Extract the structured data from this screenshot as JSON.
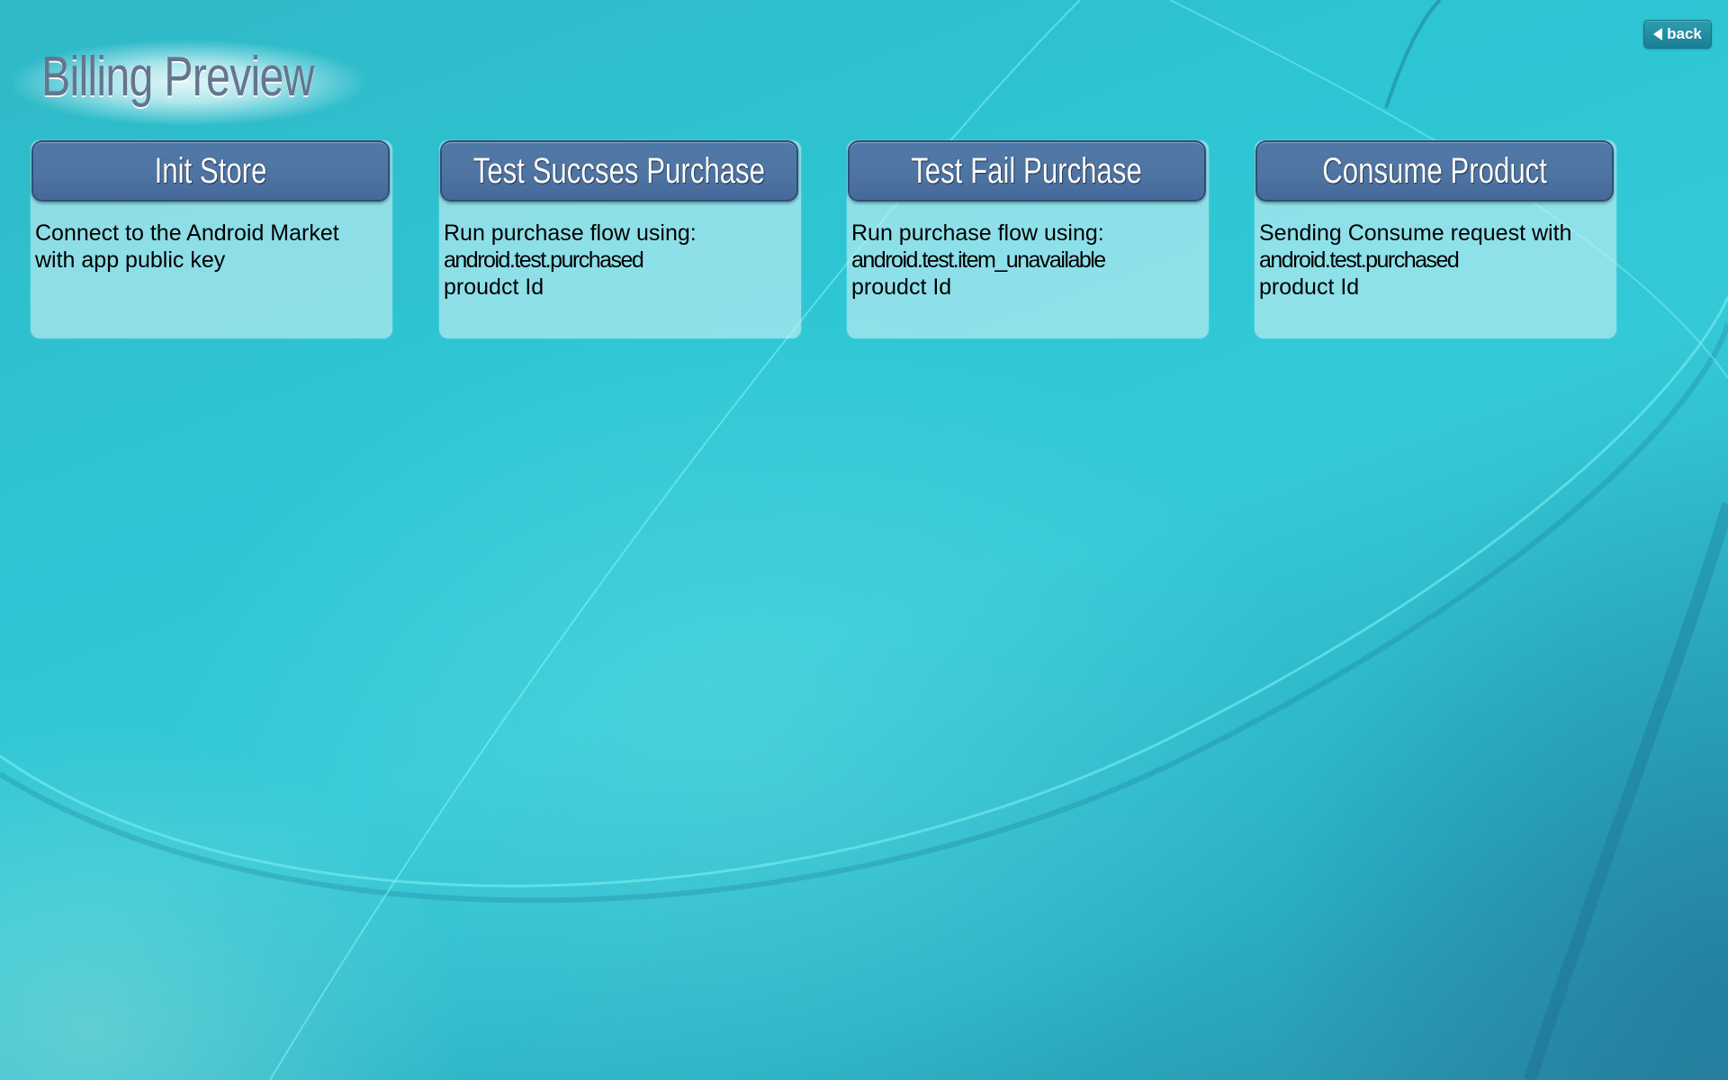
{
  "header": {
    "title": "Billing Preview",
    "back_label": "back",
    "back_icon": "triangle-left-icon"
  },
  "cards": [
    {
      "button_label": "Init Store",
      "description_lines": [
        "Connect to the Android Market",
        "with app public key",
        ""
      ]
    },
    {
      "button_label": "Test Succses Purchase",
      "description_lines": [
        "Run purchase flow using:",
        "android.test.purchased",
        "proudct Id"
      ]
    },
    {
      "button_label": "Test Fail Purchase",
      "description_lines": [
        "Run purchase flow using:",
        "android.test.item_unavailable",
        "proudct Id"
      ]
    },
    {
      "button_label": "Consume Product",
      "description_lines": [
        "Sending Consume request with",
        "android.test.purchased",
        "product Id"
      ]
    }
  ],
  "colors": {
    "background": "#2ec6d4",
    "button": "#4f76a3",
    "button_border": "#2f4e78",
    "title_text": "#66758e",
    "back_button": "#1f8ba0"
  }
}
